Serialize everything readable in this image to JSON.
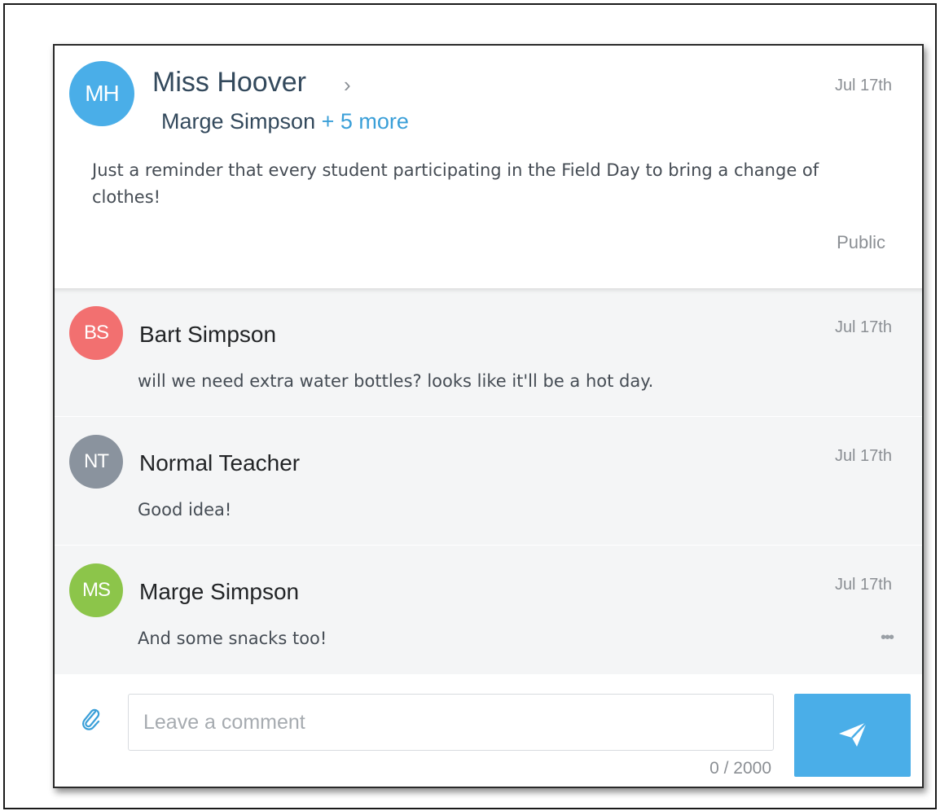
{
  "post": {
    "avatar_initials": "MH",
    "avatar_color": "#4aaee8",
    "author": "Miss Hoover",
    "chevron": "›",
    "recipient_name": "Marge Simpson",
    "recipient_more": "+ 5 more",
    "date": "Jul 17th",
    "body": "Just a reminder that every student participating in the Field Day to bring a change of clothes!",
    "visibility": "Public"
  },
  "comments": [
    {
      "avatar_initials": "BS",
      "avatar_color": "#f27070",
      "author": "Bart Simpson",
      "date": "Jul 17th",
      "text": "will we need extra water bottles? looks like it'll be a hot day."
    },
    {
      "avatar_initials": "NT",
      "avatar_color": "#8a939e",
      "author": "Normal Teacher",
      "date": "Jul 17th",
      "text": "Good idea!"
    },
    {
      "avatar_initials": "MS",
      "avatar_color": "#8cc54a",
      "author": "Marge Simpson",
      "date": "Jul 17th",
      "text": "And some snacks too!",
      "more_icon": "•••"
    }
  ],
  "composer": {
    "attach_icon": "paperclip-icon",
    "placeholder": "Leave a comment",
    "counter": "0 / 2000",
    "send_icon": "paper-plane-icon",
    "send_color": "#4aaee8"
  }
}
